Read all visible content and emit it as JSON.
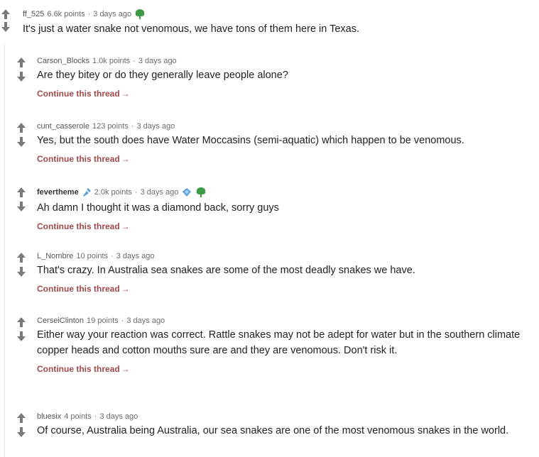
{
  "parent": {
    "author": "ff_525",
    "points": "6.6k points",
    "age": "3 days ago",
    "body": "It's just a water snake not venomous, we have tons of them here in Texas."
  },
  "comments": [
    {
      "author": "Carson_Blocks",
      "points": "1.0k points",
      "age": "3 days ago",
      "body": "Are they bitey or do they generally leave people alone?",
      "continue": "Continue this thread"
    },
    {
      "author": "cunt_casserole",
      "points": "123 points",
      "age": "3 days ago",
      "body": "Yes, but the south does have Water Moccasins (semi-aquatic) which happen to be venomous.",
      "continue": "Continue this thread"
    },
    {
      "author": "fevertheme",
      "points": "2.0k points",
      "age": "3 days ago",
      "body": "Ah damn I thought it was a diamond back, sorry guys",
      "continue": "Continue this thread"
    },
    {
      "author": "L_Nombre",
      "points": "10 points",
      "age": "3 days ago",
      "body": "That's crazy. In Australia sea snakes are some of the most deadly snakes we have.",
      "continue": "Continue this thread"
    },
    {
      "author": "CerseiClinton",
      "points": "19 points",
      "age": "3 days ago",
      "body": "Either way your reaction was correct. Rattle snakes may not be adept for water but in the southern climate copper heads and cotton mouths sure are and they are venomous. Don't risk it.",
      "continue": "Continue this thread"
    },
    {
      "author": "bluesix",
      "points": "4 points",
      "age": "3 days ago",
      "body": "Of course, Australia being Australia, our sea snakes are one of the most venomous snakes in the world."
    }
  ],
  "colors": {
    "arrow": "#7a7a7a",
    "continue_link": "#a04a4a",
    "award_green": "#3d9a45",
    "award_blue": "#5aa0d8"
  },
  "icons": {
    "upvote": "arrow-up-icon",
    "downvote": "arrow-down-icon",
    "award": "tree-award-icon",
    "flair": "microphone-icon",
    "award2": "ticket-award-icon"
  }
}
